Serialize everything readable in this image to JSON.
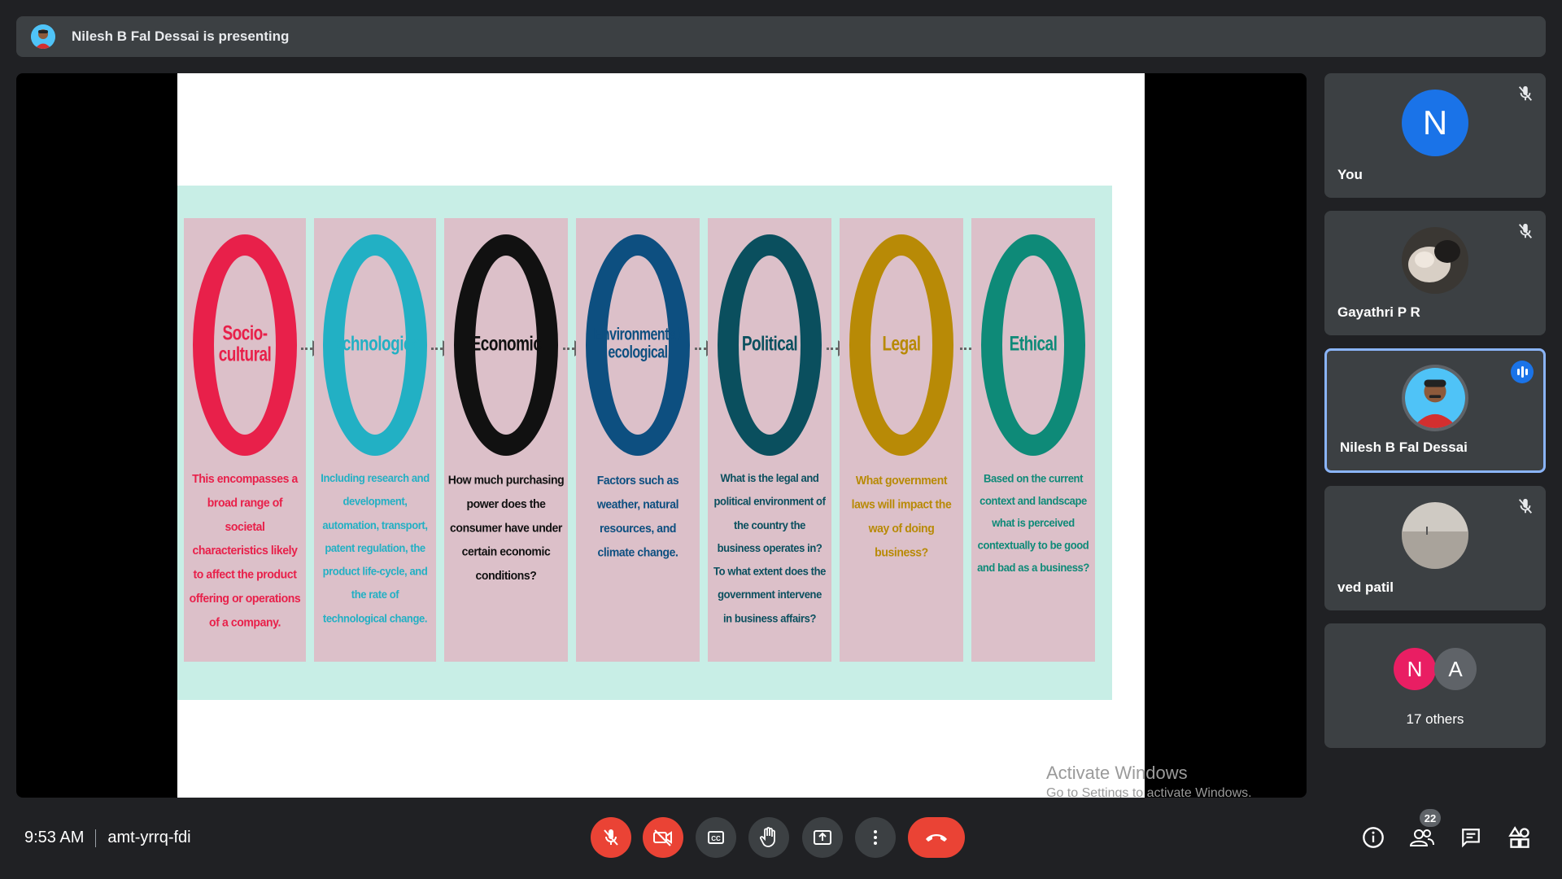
{
  "banner": {
    "text": "Nilesh B Fal Dessai is presenting"
  },
  "slide": {
    "cards": [
      {
        "title": "Socio-cultural",
        "color": "#e8204a",
        "desc": "This encompasses a broad range of societal characteristics likely to affect the product offering or operations of a company."
      },
      {
        "title": "Technological",
        "color": "#22b0c4",
        "desc": "Including research and development, automation, transport, patent regulation, the product life-cycle, and the rate of technological change."
      },
      {
        "title": "Economic",
        "color": "#111111",
        "desc": "How much purchasing power does the consumer have under certain economic conditions?"
      },
      {
        "title": "Environmental/ ecological",
        "color": "#0d4f80",
        "desc": "Factors such as weather, natural resources, and climate change."
      },
      {
        "title": "Political",
        "color": "#0a4f5e",
        "desc": "What is the legal and political environment of the country the business operates in? To what extent does the government intervene in business affairs?"
      },
      {
        "title": "Legal",
        "color": "#b88a06",
        "desc": "What government laws will impact the way of doing business?"
      },
      {
        "title": "Ethical",
        "color": "#0e8a78",
        "desc": "Based on the current context and landscape what is perceived contextually to be good and bad as a business?"
      }
    ],
    "watermark_title": "Activate Windows",
    "watermark_sub": "Go to Settings to activate Windows."
  },
  "participants": [
    {
      "name": "You",
      "initial": "N",
      "color": "#1a73e8",
      "muted": true
    },
    {
      "name": "Gayathri P R",
      "initial": "",
      "color": "#5f5a55",
      "muted": true
    },
    {
      "name": "Nilesh B Fal Dessai",
      "initial": "",
      "color": "#4fc3f7",
      "muted": false,
      "speaking": true
    },
    {
      "name": "ved patil",
      "initial": "",
      "color": "#b8b4ae",
      "muted": true
    }
  ],
  "others": {
    "a": "N",
    "b": "A",
    "label": "17 others",
    "a_color": "#e91e63",
    "b_color": "#5f6368"
  },
  "bottom": {
    "time": "9:53 AM",
    "meeting_code": "amt-yrrq-fdi",
    "people_count": "22"
  }
}
